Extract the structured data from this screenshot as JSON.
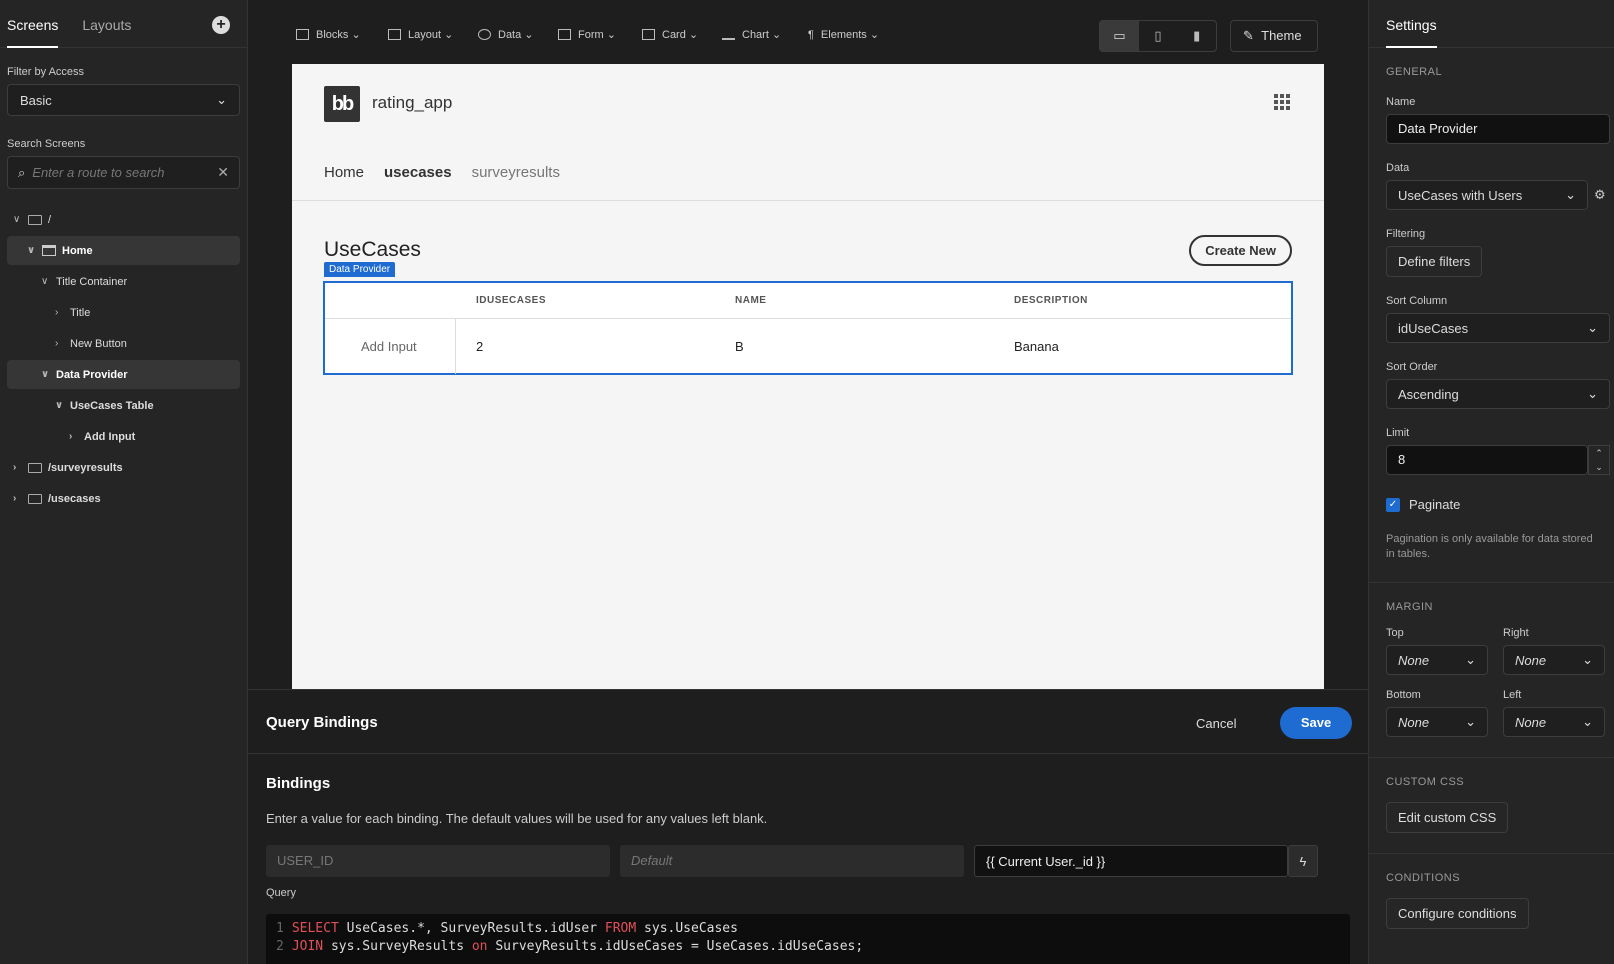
{
  "left": {
    "tabs": [
      "Screens",
      "Layouts"
    ],
    "filter_label": "Filter by Access",
    "filter_value": "Basic",
    "search_label": "Search Screens",
    "search_placeholder": "Enter a route to search",
    "tree": [
      "/",
      "Home",
      "Title Container",
      "Title",
      "New Button",
      "Data Provider",
      "UseCases Table",
      "Add Input",
      "/surveyresults",
      "/usecases"
    ]
  },
  "toolbar": {
    "items": [
      "Blocks",
      "Layout",
      "Data",
      "Form",
      "Card",
      "Chart",
      "Elements"
    ],
    "theme": "Theme"
  },
  "preview": {
    "logo": "bb",
    "app_name": "rating_app",
    "nav": [
      "Home",
      "usecases",
      "surveyresults"
    ],
    "heading": "UseCases",
    "create": "Create New",
    "dp_label": "Data Provider",
    "table": {
      "headers": [
        "IDUSECASES",
        "NAME",
        "DESCRIPTION"
      ],
      "add_input": "Add Input",
      "row": [
        "2",
        "B",
        "Banana"
      ]
    }
  },
  "query": {
    "title": "Query Bindings",
    "cancel": "Cancel",
    "save": "Save",
    "bindings_title": "Bindings",
    "desc": "Enter a value for each binding. The default values will be used for any values left blank.",
    "binding_name": "USER_ID",
    "default_placeholder": "Default",
    "binding_value": "{{ Current User._id }}",
    "query_label": "Query",
    "code": [
      {
        "n": "1",
        "kw1": "SELECT",
        "t1": " UseCases.*, SurveyResults.idUser ",
        "kw2": "FROM",
        "t2": " sys.UseCases"
      },
      {
        "n": "2",
        "kw1": "JOIN",
        "t1": " sys.SurveyResults ",
        "kw2": "on",
        "t2": " SurveyResults.idUseCases = UseCases.idUseCases;"
      }
    ]
  },
  "settings": {
    "tab": "Settings",
    "general": "GENERAL",
    "name_label": "Name",
    "name_value": "Data Provider",
    "data_label": "Data",
    "data_value": "UseCases with Users",
    "filtering_label": "Filtering",
    "filter_btn": "Define filters",
    "sort_col_label": "Sort Column",
    "sort_col": "idUseCases",
    "sort_order_label": "Sort Order",
    "sort_order": "Ascending",
    "limit_label": "Limit",
    "limit": "8",
    "paginate": "Paginate",
    "paginate_note": "Pagination is only available for data stored in tables.",
    "margin": "MARGIN",
    "top": "Top",
    "right": "Right",
    "bottom": "Bottom",
    "left": "Left",
    "none": "None",
    "custom_css": "CUSTOM CSS",
    "edit_css": "Edit custom CSS",
    "conditions": "CONDITIONS",
    "configure": "Configure conditions"
  }
}
